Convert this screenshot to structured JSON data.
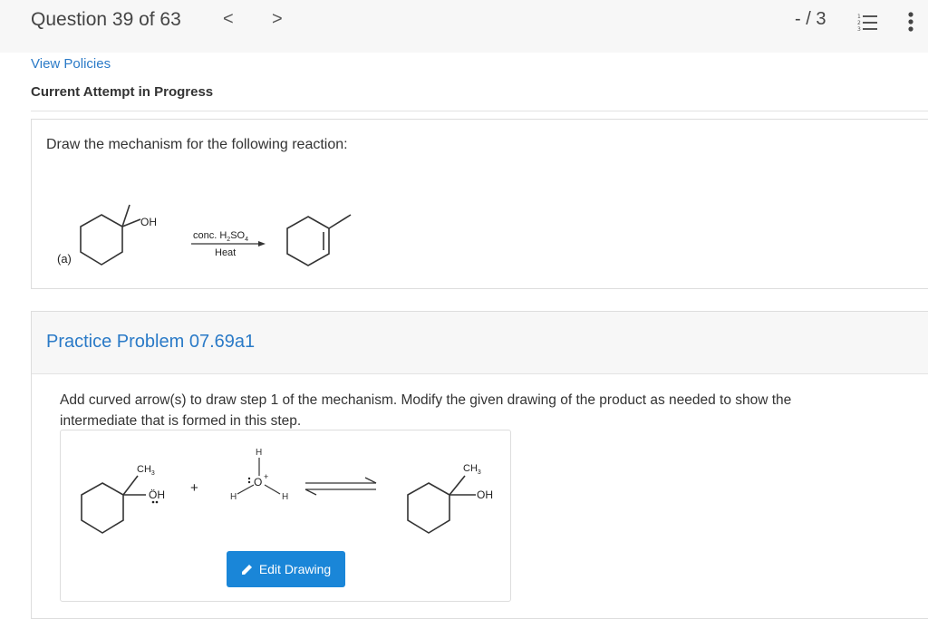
{
  "header": {
    "question_label": "Question 39 of 63",
    "prev_glyph": "<",
    "next_glyph": ">",
    "score": "- / 3",
    "list_icon": "numbered-list-icon",
    "more_icon": "vertical-ellipsis-icon"
  },
  "policies_link": "View Policies",
  "attempt_status": "Current Attempt in Progress",
  "question": {
    "prompt": "Draw the mechanism for the following reaction:",
    "part_label": "(a)",
    "reactant_group": "OH",
    "reagent_prefix": "conc. H",
    "reagent_sub1": "2",
    "reagent_mid": "SO",
    "reagent_sub2": "4",
    "condition": "Heat"
  },
  "practice": {
    "title": "Practice Problem 07.69a1",
    "instructions": "Add curved arrow(s) to draw step 1 of the mechanism. Modify the given drawing of the product as needed to show the intermediate that is formed in this step.",
    "drawing": {
      "methyl_c": "CH",
      "methyl_sub": "3",
      "alcohol_oh": "ÖH",
      "plus": "+",
      "hydronium_h_top": "H",
      "hydronium_o": "O",
      "hydronium_charge": "+",
      "hydronium_h_left": "H",
      "hydronium_h_right": "H",
      "product_methyl_c": "CH",
      "product_methyl_sub": "3",
      "product_oh": "OH"
    },
    "edit_button": "Edit Drawing",
    "edit_icon": "pencil-icon"
  }
}
